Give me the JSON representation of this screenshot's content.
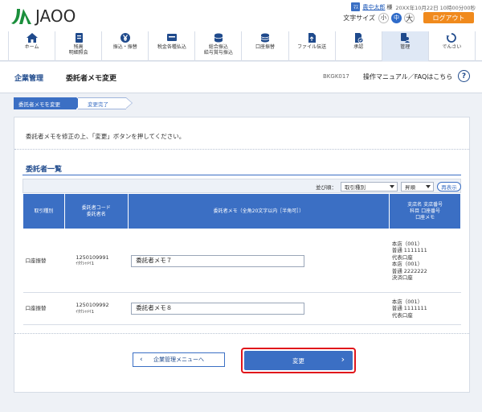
{
  "header": {
    "logo_text": "JAOO",
    "user_icon_text": "ﾏｽ",
    "user_name": "農中太郎",
    "user_suffix": "様",
    "login_time": "20XX年10月22日 10時00分00秒",
    "font_size_label": "文字サイズ",
    "font_small": "小",
    "font_medium": "中",
    "font_large": "大",
    "logout_label": "ログアウト"
  },
  "nav": [
    {
      "label": "ホーム",
      "icon": "home-icon"
    },
    {
      "label": "残高\n明細照会",
      "icon": "book-icon"
    },
    {
      "label": "振込・振替",
      "icon": "yen-circle-icon"
    },
    {
      "label": "税金各種払込",
      "icon": "card-icon"
    },
    {
      "label": "総合振込\n給与賞与振込",
      "icon": "coins-icon"
    },
    {
      "label": "口座振替",
      "icon": "coins-stack-icon"
    },
    {
      "label": "ファイル伝送",
      "icon": "file-icon"
    },
    {
      "label": "承認",
      "icon": "approve-icon"
    },
    {
      "label": "管理",
      "icon": "admin-icon",
      "active": true
    },
    {
      "label": "でんさい",
      "icon": "densai-icon"
    }
  ],
  "titlebar": {
    "section": "企業管理",
    "title": "委託者メモ変更",
    "code": "BKGK017",
    "help_text": "操作マニュアル／FAQはこちら",
    "help_icon": "?"
  },
  "steps": [
    "委託者メモを変更",
    "変更完了"
  ],
  "instruction": "委託者メモを修正の上、「変更」ボタンを押してください。",
  "list": {
    "title": "委託者一覧",
    "sort_label": "並び順：",
    "sort_key": "取引種別",
    "sort_order": "昇順",
    "redisplay_label": "再表示",
    "headers": {
      "type": "取引種別",
      "code_line1": "委託者コード",
      "code_line2": "委託者名",
      "memo": "委託者メモ（全角20文字以内［半角可］）",
      "branch_line1": "支店名 支店番号",
      "branch_line2": "科目 口座番号",
      "branch_line3": "口座メモ"
    },
    "rows": [
      {
        "type": "口座振替",
        "code": "1250109991",
        "name": "ｲﾀｸｼｬﾒｲ1",
        "memo": "委託者メモ７",
        "bank": "本店（001）\n普通 1111111\n代表口座\n本店（001）\n普通 2222222\n決済口座"
      },
      {
        "type": "口座振替",
        "code": "1250109992",
        "name": "ｲﾀｸｼｬﾒｲ1",
        "memo": "委託者メモ８",
        "bank": "本店（001）\n普通 1111111\n代表口座"
      }
    ]
  },
  "buttons": {
    "back": "企業管理メニューへ",
    "change": "変更"
  },
  "colors": {
    "primary": "#3b6fc4",
    "accent": "#f08a1d",
    "highlight": "#e0151b"
  }
}
